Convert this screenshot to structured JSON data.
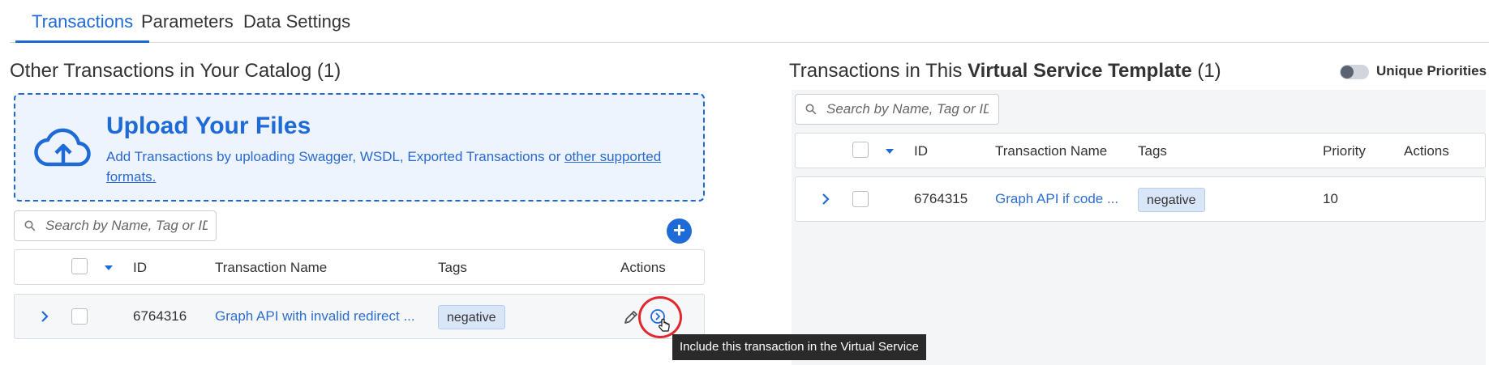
{
  "tabs": [
    {
      "label": "Transactions",
      "active": true
    },
    {
      "label": "Parameters",
      "active": false
    },
    {
      "label": "Data Settings",
      "active": false
    }
  ],
  "left": {
    "title": "Other Transactions in Your Catalog (1)",
    "upload": {
      "title": "Upload Your Files",
      "desc_prefix": "Add Transactions by uploading Swagger, WSDL, Exported Transactions or ",
      "desc_link": "other supported formats."
    },
    "search": {
      "placeholder": "Search by Name, Tag or ID"
    },
    "add_label": "+",
    "columns": {
      "id": "ID",
      "name": "Transaction Name",
      "tags": "Tags",
      "actions": "Actions"
    },
    "rows": [
      {
        "id": "6764316",
        "name": "Graph API with invalid redirect ...",
        "tag": "negative"
      }
    ]
  },
  "right": {
    "title_prefix": "Transactions in This ",
    "title_bold": "Virtual Service Template",
    "title_suffix": " (1)",
    "toggle_label": "Unique Priorities",
    "toggle_on": false,
    "search": {
      "placeholder": "Search by Name, Tag or ID"
    },
    "columns": {
      "id": "ID",
      "name": "Transaction Name",
      "tags": "Tags",
      "priority": "Priority",
      "actions": "Actions"
    },
    "rows": [
      {
        "id": "6764315",
        "name": "Graph API if code ...",
        "tag": "negative",
        "priority": "10"
      }
    ]
  },
  "tooltip": "Include this transaction in the Virtual Service",
  "colors": {
    "accent": "#1e6ad6",
    "highlight": "#e0292f"
  },
  "icons": {
    "upload": "cloud-upload-icon",
    "search": "search-icon",
    "edit": "pencil-icon",
    "include": "circle-arrow-right-icon",
    "expand": "chevron-right-icon"
  }
}
